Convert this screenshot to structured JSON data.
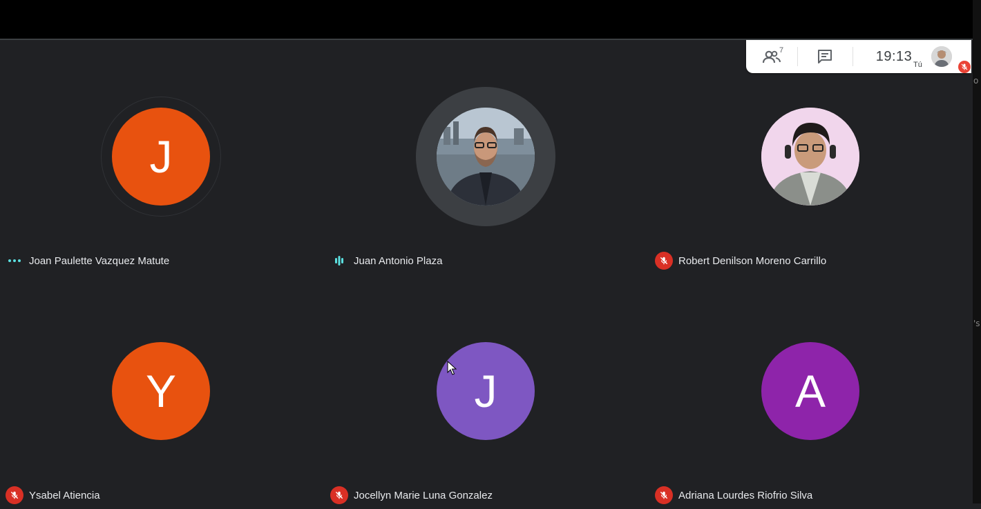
{
  "toolbar": {
    "participant_count": "7",
    "time": "19:13",
    "you_label": "Tú",
    "icons": {
      "people": "people-icon",
      "chat": "chat-icon",
      "muted": "mic-off-icon"
    }
  },
  "participants": [
    {
      "name": "Joan Paulette Vazquez Matute",
      "initial": "J",
      "avatar_type": "letter",
      "color": "#e8520f",
      "status": "connecting-dots"
    },
    {
      "name": "Juan Antonio Plaza",
      "initial": "",
      "avatar_type": "photo",
      "color": "#5f6368",
      "status": "speaking"
    },
    {
      "name": "Robert Denilson Moreno Carrillo",
      "initial": "",
      "avatar_type": "photo",
      "color": "#f1d3ea",
      "status": "muted"
    },
    {
      "name": "Ysabel Atiencia",
      "initial": "Y",
      "avatar_type": "letter",
      "color": "#e8520f",
      "status": "muted"
    },
    {
      "name": "Jocellyn Marie Luna Gonzalez",
      "initial": "J",
      "avatar_type": "letter",
      "color": "#7e57c2",
      "status": "muted"
    },
    {
      "name": "Adriana Lourdes Riofrio Silva",
      "initial": "A",
      "avatar_type": "letter",
      "color": "#8e24aa",
      "status": "muted"
    }
  ],
  "colors": {
    "background": "#202124",
    "muted_badge": "#d93025",
    "activity": "#5be0e0"
  }
}
